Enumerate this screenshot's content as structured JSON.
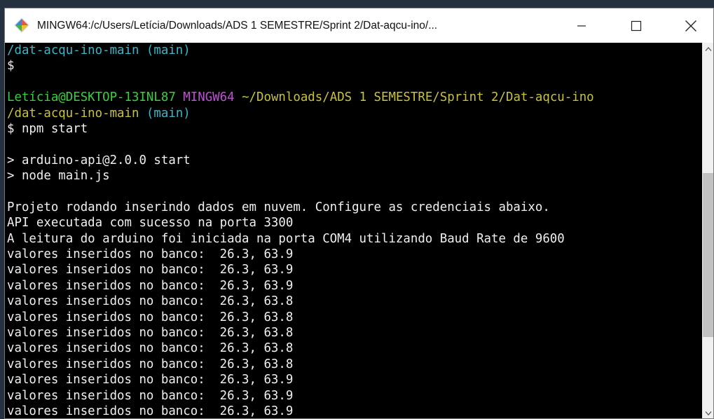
{
  "window": {
    "title": "MINGW64:/c/Users/Letícia/Downloads/ADS 1 SEMESTRE/Sprint 2/Dat-aqcu-ino/...",
    "minimize_label": "—",
    "maximize_label": "☐",
    "close_label": "✕"
  },
  "terminal": {
    "line0": "/dat-acqu-ino-main (main)",
    "line1": "$",
    "line2": "",
    "prompt": {
      "user_host": "Letícia@DESKTOP-13INL87",
      "system": "MINGW64",
      "path": "~/Downloads/ADS 1 SEMESTRE/Sprint 2/Dat-aqcu-ino",
      "path_cont": "/dat-acqu-ino-main",
      "branch": "(main)"
    },
    "command": "$ npm start",
    "line6": "",
    "script_line1": "> arduino-api@2.0.0 start",
    "script_line2": "> node main.js",
    "line9": "",
    "output": [
      "Projeto rodando inserindo dados em nuvem. Configure as credenciais abaixo.",
      "API executada com sucesso na porta 3300",
      "A leitura do arduino foi iniciada na porta COM4 utilizando Baud Rate de 9600",
      "valores inseridos no banco:  26.3, 63.9",
      "valores inseridos no banco:  26.3, 63.9",
      "valores inseridos no banco:  26.3, 63.9",
      "valores inseridos no banco:  26.3, 63.8",
      "valores inseridos no banco:  26.3, 63.8",
      "valores inseridos no banco:  26.3, 63.8",
      "valores inseridos no banco:  26.3, 63.8",
      "valores inseridos no banco:  26.3, 63.8",
      "valores inseridos no banco:  26.3, 63.9",
      "valores inseridos no banco:  26.3, 63.9",
      "valores inseridos no banco:  26.3, 63.9"
    ]
  },
  "colors": {
    "prompt_user": "#36d23c",
    "prompt_system": "#c24fd6",
    "prompt_path": "#c9c23b",
    "prompt_branch": "#3bb6c9"
  }
}
